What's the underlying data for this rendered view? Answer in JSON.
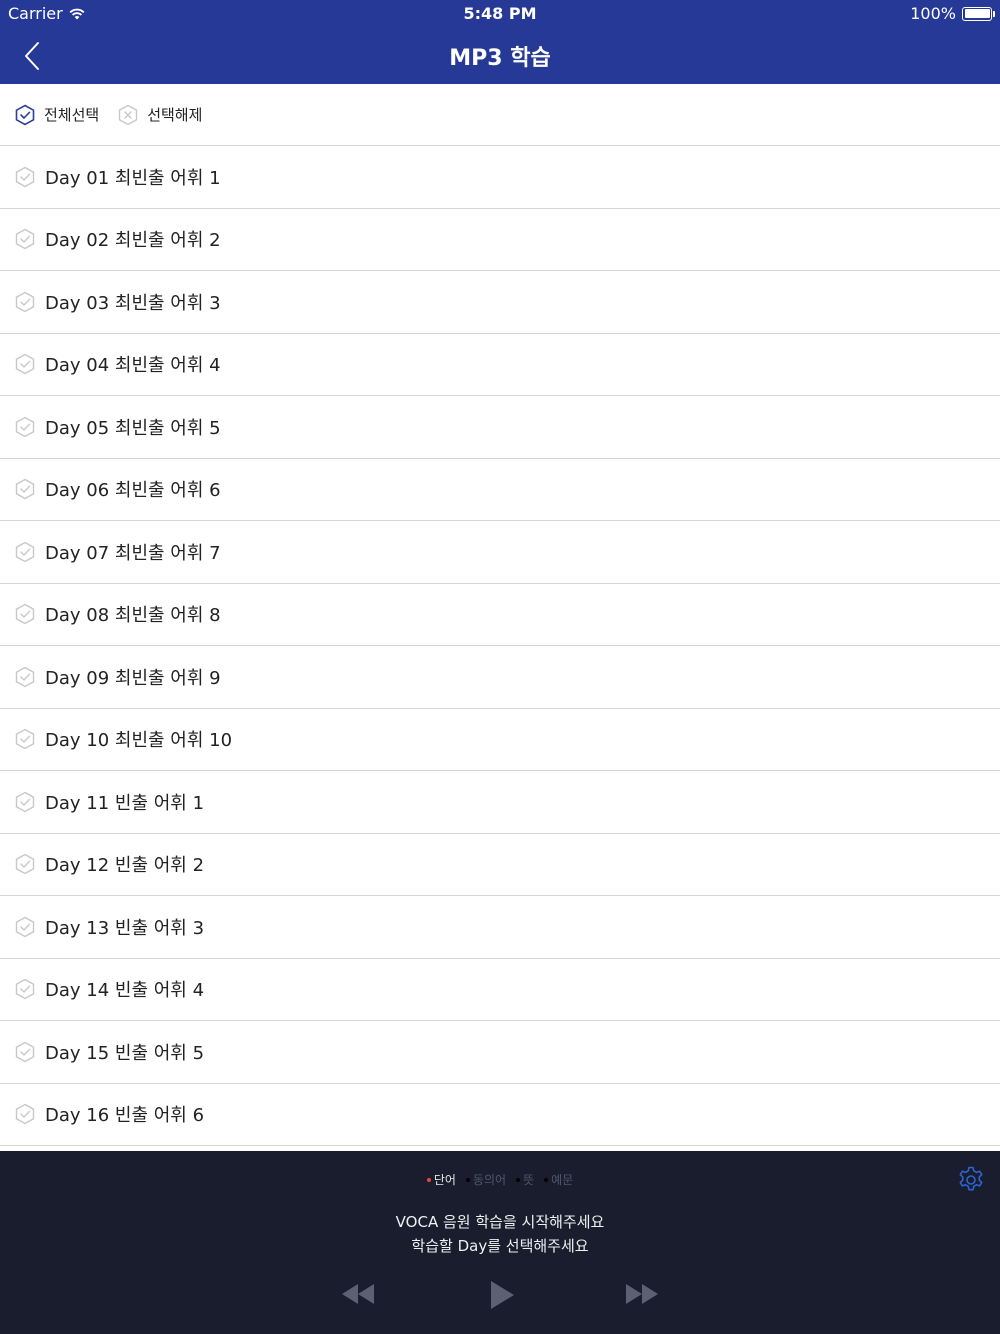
{
  "status_bar": {
    "carrier": "Carrier",
    "time": "5:48 PM",
    "battery": "100%",
    "battery_level": 1.0
  },
  "nav": {
    "title": "MP3 학습",
    "back_icon": "chevron-left-icon"
  },
  "toolbar": {
    "select_all_label": "전체선택",
    "deselect_label": "선택해제"
  },
  "days": [
    {
      "label": "Day 01  최빈출 어휘 1"
    },
    {
      "label": "Day 02  최빈출 어휘 2"
    },
    {
      "label": "Day 03  최빈출 어휘 3"
    },
    {
      "label": "Day 04  최빈출 어휘 4"
    },
    {
      "label": "Day 05  최빈출 어휘 5"
    },
    {
      "label": "Day 06  최빈출 어휘 6"
    },
    {
      "label": "Day 07  최빈출 어휘 7"
    },
    {
      "label": "Day 08  최빈출 어휘 8"
    },
    {
      "label": "Day 09  최빈출 어휘 9"
    },
    {
      "label": "Day 10  최빈출 어휘 10"
    },
    {
      "label": "Day 11  빈출 어휘 1"
    },
    {
      "label": "Day 12  빈출 어휘 2"
    },
    {
      "label": "Day 13  빈출 어휘 3"
    },
    {
      "label": "Day 14  빈출 어휘 4"
    },
    {
      "label": "Day 15  빈출 어휘 5"
    },
    {
      "label": "Day 16  빈출 어휘 6"
    }
  ],
  "player": {
    "modes": [
      {
        "label": "단어",
        "active": true
      },
      {
        "label": "동의어",
        "active": false
      },
      {
        "label": "뜻",
        "active": false
      },
      {
        "label": "예문",
        "active": false
      }
    ],
    "message_line1": "VOCA 음원 학습을 시작해주세요",
    "message_line2": "학습할 Day를 선택해주세요"
  },
  "colors": {
    "header_bg": "#263996",
    "player_bg": "#191d2e",
    "accent_active_dot": "#e8463a",
    "check_active": "#2c3e9e",
    "check_inactive": "#c8c8c8"
  }
}
